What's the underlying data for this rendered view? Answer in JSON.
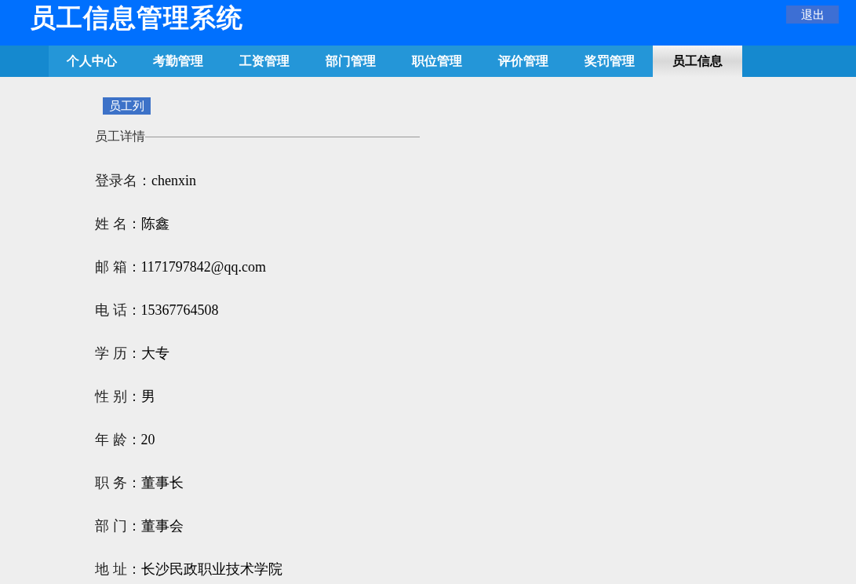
{
  "header": {
    "title": "员工信息管理系统",
    "logout": "退出"
  },
  "nav": [
    {
      "label": "个人中心",
      "selected": false
    },
    {
      "label": "考勤管理",
      "selected": false
    },
    {
      "label": "工资管理",
      "selected": false
    },
    {
      "label": "部门管理",
      "selected": false
    },
    {
      "label": "职位管理",
      "selected": false
    },
    {
      "label": "评价管理",
      "selected": false
    },
    {
      "label": "奖罚管理",
      "selected": false
    },
    {
      "label": "员工信息",
      "selected": true
    }
  ],
  "list_button": "员工列",
  "section_title": "员工详情",
  "fields": [
    {
      "label": "登录名：",
      "value": "chenxin"
    },
    {
      "label": "姓 名：",
      "value": "陈鑫"
    },
    {
      "label": "邮 箱：",
      "value": "1171797842@qq.com"
    },
    {
      "label": "电 话：",
      "value": "15367764508"
    },
    {
      "label": "学 历：",
      "value": "大专"
    },
    {
      "label": "性 别：",
      "value": "男"
    },
    {
      "label": "年 龄：",
      "value": "20"
    },
    {
      "label": "职 务：",
      "value": "董事长"
    },
    {
      "label": "部 门：",
      "value": "董事会"
    },
    {
      "label": "地 址：",
      "value": "长沙民政职业技术学院"
    }
  ]
}
